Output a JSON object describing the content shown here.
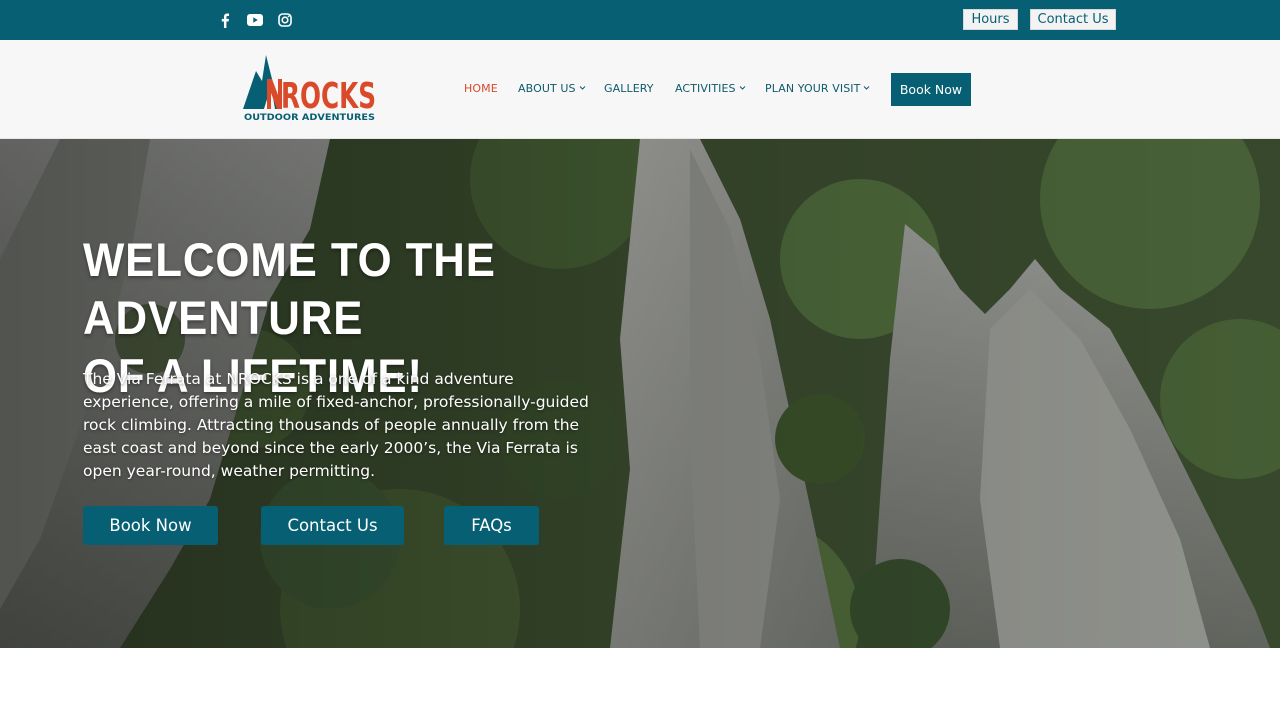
{
  "topbar": {
    "social_icons": [
      "facebook-icon",
      "youtube-icon",
      "instagram-icon"
    ],
    "hours_label": "Hours",
    "contact_label": "Contact Us",
    "bg_color": "#075f73"
  },
  "header": {
    "logo": {
      "name": "NROCKS",
      "tagline": "OUTDOOR ADVENTURES"
    },
    "nav": [
      {
        "label": "HOME",
        "active": true
      },
      {
        "label": "ABOUT US",
        "dropdown": true
      },
      {
        "label": "GALLERY"
      },
      {
        "label": "ACTIVITIES",
        "dropdown": true
      },
      {
        "label": "PLAN YOUR VISIT",
        "dropdown": true
      }
    ],
    "book_label": "Book Now"
  },
  "hero": {
    "title_line1": "WELCOME TO THE ADVENTURE",
    "title_line2": "OF A LIFETIME!",
    "description": "The Via Ferrata at NROCKS is a one of a kind adventure experience, offering a mile of fixed-anchor, professionally-guided rock climbing. Attracting thousands of people annually from the east coast and beyond since the early 2000’s, the Via Ferrata is open year-round, weather permitting.",
    "buttons": [
      "Book Now",
      "Contact Us",
      "FAQs"
    ]
  },
  "colors": {
    "primary": "#075f73",
    "accent": "#d9492a",
    "header_bg": "#f7f7f7"
  }
}
